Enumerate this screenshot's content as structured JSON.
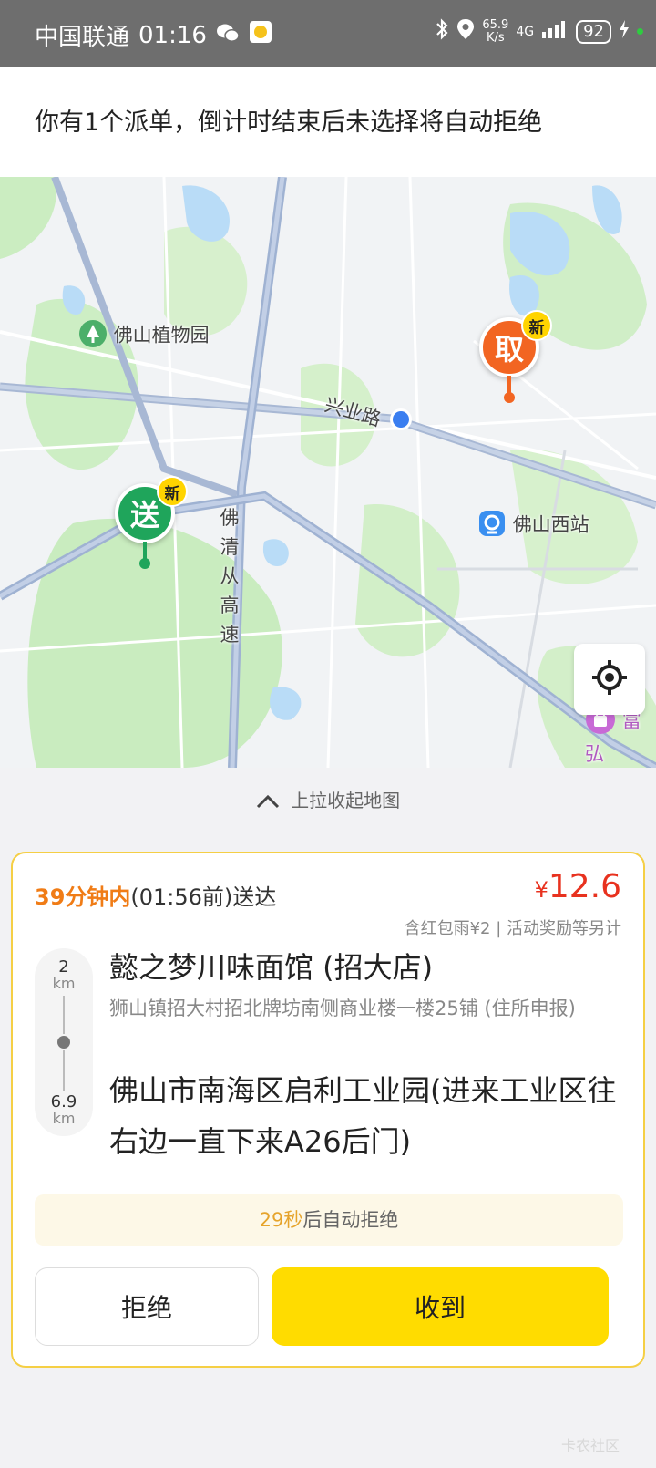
{
  "status_bar": {
    "carrier": "中国联通",
    "time": "01:16",
    "net_speed_value": "65.9",
    "net_speed_unit": "K/s",
    "network": "4G",
    "battery": "92"
  },
  "notice": "你有1个派单，倒计时结束后未选择将自动拒绝",
  "map": {
    "pickup_pin": "取",
    "dropoff_pin": "送",
    "new_badge": "新",
    "labels": {
      "botanical_garden": "佛山植物园",
      "xingye_road": "兴业路",
      "foshan_west_station": "佛山西站",
      "foqing_highway": "佛清从高速",
      "fu": "富弘"
    }
  },
  "collapse_hint": "上拉收起地图",
  "order": {
    "eta_highlight": "39分钟内",
    "eta_rest": "(01:56前)送达",
    "price_symbol": "¥",
    "price": "12.6",
    "price_note": "含红包雨¥2 | 活动奖励等另计",
    "pickup_distance": "2",
    "dropoff_distance": "6.9",
    "distance_unit": "km",
    "pickup_name": "懿之梦川味面馆 (招大店)",
    "pickup_address": "狮山镇招大村招北牌坊南侧商业楼一楼25铺 (住所申报)",
    "dropoff_address": "佛山市南海区启利工业园(进来工业区往右边一直下来A26后门)",
    "countdown_seconds": "29秒",
    "countdown_text": "后自动拒绝",
    "reject_label": "拒绝",
    "accept_label": "收到"
  },
  "colors": {
    "pickup": "#f26522",
    "dropoff": "#1fa55b",
    "accent": "#ffdc00",
    "price": "#e8321f",
    "eta": "#f07c16"
  },
  "watermark": "卡农社区"
}
